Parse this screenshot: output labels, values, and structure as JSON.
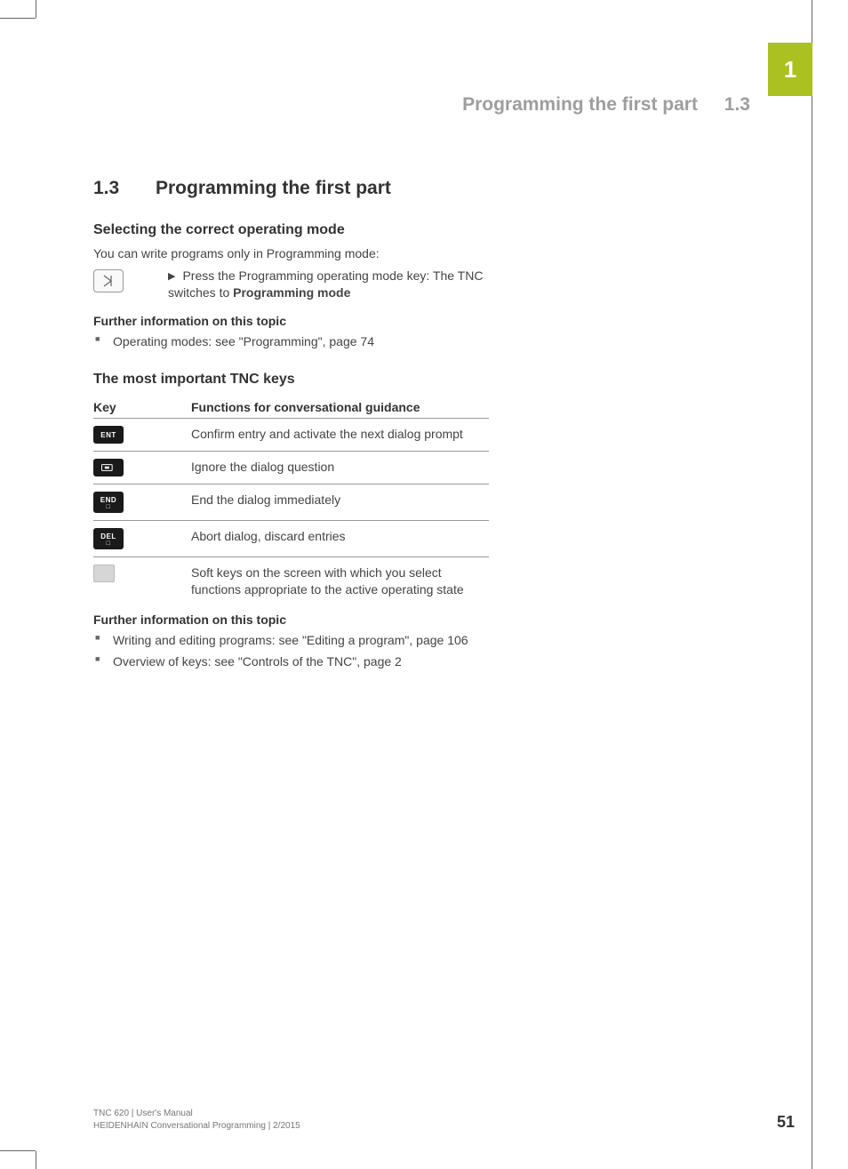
{
  "chapter_tab": "1",
  "running_head": {
    "title": "Programming the first part",
    "num": "1.3"
  },
  "section": {
    "num": "1.3",
    "title": "Programming the first part"
  },
  "sub1": {
    "title": "Selecting the correct operating mode",
    "intro": "You can write programs only in Programming mode:",
    "step_prefix": "Press the Programming operating mode key: The TNC switches to ",
    "step_bold": "Programming mode"
  },
  "further1": {
    "heading": "Further information on this topic",
    "items": [
      "Operating modes: see \"Programming\", page 74"
    ]
  },
  "sub2": {
    "title": "The most important TNC keys",
    "col_key": "Key",
    "col_fn": "Functions for conversational guidance",
    "rows": [
      {
        "key_label": "ENT",
        "fn": "Confirm entry and activate the next dialog prompt"
      },
      {
        "key_label": "NO ENT",
        "fn": "Ignore the dialog question"
      },
      {
        "key_label": "END",
        "fn": "End the dialog immediately"
      },
      {
        "key_label": "DEL",
        "fn": "Abort dialog, discard entries"
      },
      {
        "key_label": "SOFTKEY",
        "fn": "Soft keys on the screen with which you select functions appropriate to the active operating state"
      }
    ]
  },
  "further2": {
    "heading": "Further information on this topic",
    "items": [
      "Writing and editing programs: see \"Editing a program\", page 106",
      "Overview of keys: see \"Controls of the TNC\", page 2"
    ]
  },
  "footer": {
    "line1": "TNC 620 | User's Manual",
    "line2": "HEIDENHAIN Conversational Programming | 2/2015",
    "page": "51"
  }
}
